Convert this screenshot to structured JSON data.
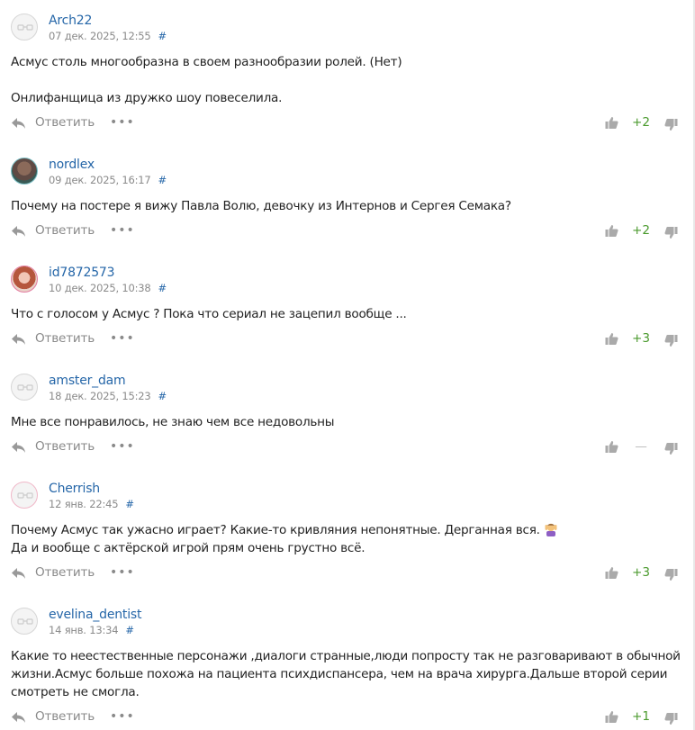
{
  "reply_label": "Ответить",
  "more_label": "•••",
  "comments": [
    {
      "author": "Arch22",
      "date": "07 дек. 2025, 12:55",
      "hash": "#",
      "lines": [
        "Асмус столь многообразна в своем разнообразии ролей. (Нет)",
        "",
        "Онлифанщица из дружко шоу повеселила."
      ],
      "score": "+2"
    },
    {
      "author": "nordlex",
      "date": "09 дек. 2025, 16:17",
      "hash": "#",
      "lines": [
        "Почему на постере я вижу Павла Волю, девочку из Интернов и Сергея Семака?"
      ],
      "score": "+2"
    },
    {
      "author": "id7872573",
      "date": "10 дек. 2025, 10:38",
      "hash": "#",
      "lines": [
        "Что с голосом у Асмус ? Пока что сериал не зацепил вообще ..."
      ],
      "score": "+3"
    },
    {
      "author": "amster_dam",
      "date": "18 дек. 2025, 15:23",
      "hash": "#",
      "lines": [
        "Мне все понравилось, не знаю чем все недовольны"
      ],
      "score": "—"
    },
    {
      "author": "Cherrish",
      "date": "12 янв. 22:45",
      "hash": "#",
      "lines": [
        "Почему Асмус так ужасно играет? Какие-то кривляния непонятные. Дерганная вся.",
        "Да и вообще с актёрской игрой прям очень грустно всё."
      ],
      "score": "+3"
    },
    {
      "author": "evelina_dentist",
      "date": "14 янв. 13:34",
      "hash": "#",
      "lines": [
        "Какие то неестественные персонажи ,диалоги странные,люди попросту так не разговаривают в обычной",
        "жизни.Асмус больше похожа на пациента психдиспансера, чем на врача хирурга.Дальше второй серии",
        "смотреть не смогла."
      ],
      "score": "+1"
    }
  ]
}
